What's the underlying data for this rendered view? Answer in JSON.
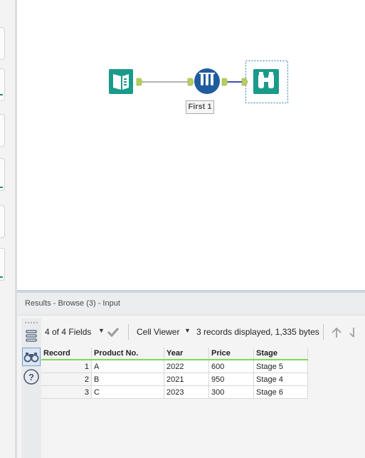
{
  "workflow": {
    "tools": [
      {
        "name": "Input Data",
        "icon": "book-icon",
        "color": "#1a9b8a"
      },
      {
        "name": "Sample",
        "icon": "test-tubes-icon",
        "color": "#1f5c9e"
      },
      {
        "name": "Browse",
        "icon": "binoculars-icon",
        "color": "#1a9b8a"
      }
    ],
    "sample_label": "First 1",
    "connection_colors": {
      "normal": "#9a9a9a",
      "selected": "#4a4ab8",
      "anchor": "#b5cf5a"
    }
  },
  "results": {
    "title": "Results - Browse (3) - Input",
    "fields_label": "4 of 4 Fields",
    "cell_viewer_label": "Cell Viewer",
    "records_info": "3 records displayed, 1,335 bytes",
    "columns": [
      "Record",
      "Product No.",
      "Year",
      "Price",
      "Stage"
    ],
    "rows": [
      {
        "record": "1",
        "product": "A",
        "year": "2022",
        "price": "600",
        "stage": "Stage 5"
      },
      {
        "record": "2",
        "product": "B",
        "year": "2021",
        "price": "950",
        "stage": "Stage 4"
      },
      {
        "record": "3",
        "product": "C",
        "year": "2023",
        "price": "300",
        "stage": "Stage 6"
      }
    ]
  }
}
